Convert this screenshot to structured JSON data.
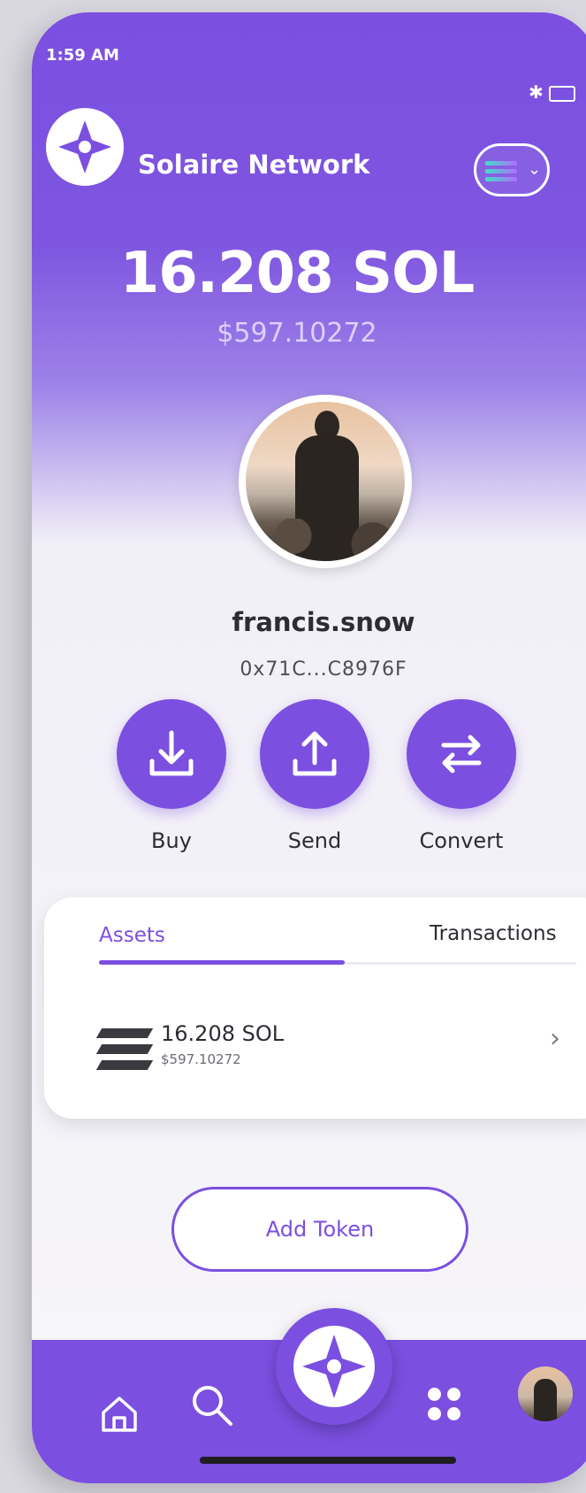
{
  "status_bar": {
    "time": "1:59 AM"
  },
  "header": {
    "title": "Solaire Network"
  },
  "balance": {
    "amount": "16.208 SOL",
    "usd": "$597.10272"
  },
  "profile": {
    "username": "francis.snow",
    "address": "0x71C...C8976F"
  },
  "actions": [
    {
      "label": "Buy",
      "icon": "download-icon"
    },
    {
      "label": "Send",
      "icon": "upload-icon"
    },
    {
      "label": "Convert",
      "icon": "convert-icon"
    }
  ],
  "tabs": [
    {
      "label": "Assets",
      "active": true
    },
    {
      "label": "Transactions",
      "active": false
    }
  ],
  "assets": [
    {
      "amount": "16.208 SOL",
      "value": "$597.10272",
      "icon": "solana-icon"
    }
  ],
  "add_token": {
    "label": "Add Token"
  },
  "nav": {
    "items": [
      "home-icon",
      "search-icon",
      "solaire-logo-icon",
      "apps-icon",
      "avatar"
    ]
  },
  "colors": {
    "accent": "#7b4fe0",
    "text": "#2c2c33",
    "background": "#f7f6fa"
  }
}
